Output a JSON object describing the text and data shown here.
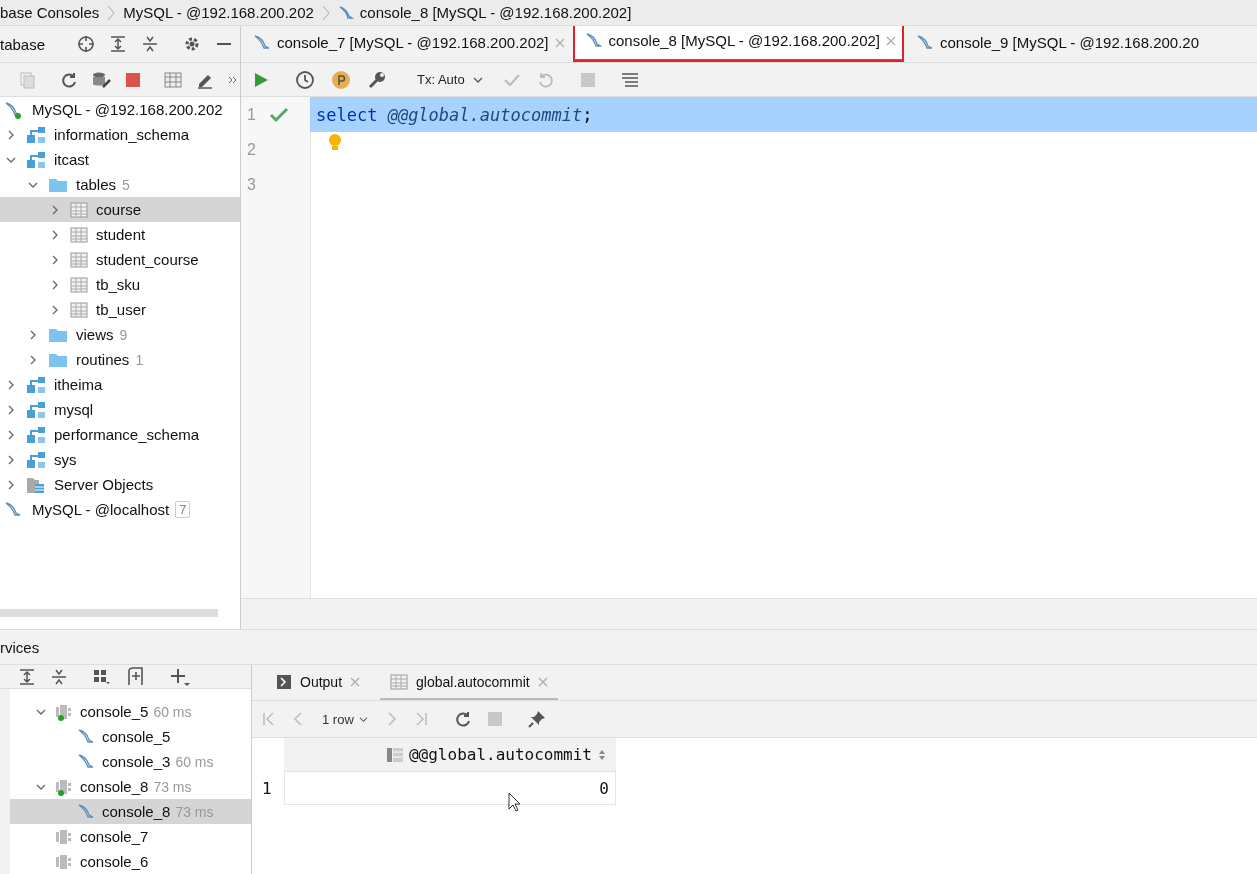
{
  "breadcrumbs": [
    {
      "text": "base Consoles",
      "kind": "plain"
    },
    {
      "text": "MySQL - @192.168.200.202",
      "kind": "plain"
    },
    {
      "text": "console_8 [MySQL - @192.168.200.202]",
      "kind": "console"
    }
  ],
  "database_panel": {
    "title": "tabase",
    "tree": [
      {
        "label": "MySQL - @192.168.200.202",
        "kind": "connection",
        "connected": true,
        "selected": false,
        "children": [
          {
            "label": "information_schema",
            "kind": "schema",
            "expanded": false,
            "selected": false
          },
          {
            "label": "itcast",
            "kind": "schema",
            "expanded": true,
            "selected": false,
            "children": [
              {
                "label": "tables",
                "count": "5",
                "kind": "folder",
                "expanded": true,
                "selected": false,
                "children": [
                  {
                    "label": "course",
                    "kind": "table",
                    "expanded": false,
                    "selected": true
                  },
                  {
                    "label": "student",
                    "kind": "table",
                    "expanded": false,
                    "selected": false
                  },
                  {
                    "label": "student_course",
                    "kind": "table",
                    "expanded": false,
                    "selected": false
                  },
                  {
                    "label": "tb_sku",
                    "kind": "table",
                    "expanded": false,
                    "selected": false
                  },
                  {
                    "label": "tb_user",
                    "kind": "table",
                    "expanded": false,
                    "selected": false
                  }
                ]
              },
              {
                "label": "views",
                "count": "9",
                "kind": "folder",
                "expanded": false,
                "selected": false
              },
              {
                "label": "routines",
                "count": "1",
                "kind": "folder",
                "expanded": false,
                "selected": false
              }
            ]
          },
          {
            "label": "itheima",
            "kind": "schema",
            "expanded": false,
            "selected": false
          },
          {
            "label": "mysql",
            "kind": "schema",
            "expanded": false,
            "selected": false
          },
          {
            "label": "performance_schema",
            "kind": "schema",
            "expanded": false,
            "selected": false
          },
          {
            "label": "sys",
            "kind": "schema",
            "expanded": false,
            "selected": false
          },
          {
            "label": "Server Objects",
            "kind": "server",
            "expanded": false,
            "selected": false
          }
        ]
      },
      {
        "label": "MySQL - @localhost",
        "count": "7",
        "kind": "connection",
        "connected": false,
        "selected": false
      }
    ]
  },
  "editor_tabs": [
    {
      "label": "console_7 [MySQL - @192.168.200.202]",
      "selected": false,
      "closable": true,
      "highlighted": false
    },
    {
      "label": "console_8 [MySQL - @192.168.200.202]",
      "selected": true,
      "closable": true,
      "highlighted": true
    },
    {
      "label": "console_9 [MySQL - @192.168.200.20",
      "selected": false,
      "closable": false,
      "highlighted": false
    }
  ],
  "editor_toolbar": {
    "transaction": "Tx: Auto"
  },
  "editor": {
    "lines": [
      {
        "number": "1",
        "executed": true,
        "selected": true,
        "hint": false,
        "tokens": [
          {
            "text": "select",
            "kind": "keyword"
          },
          {
            "text": " @@global.autocommit",
            "kind": "variable"
          },
          {
            "text": ";",
            "kind": "punct"
          }
        ]
      },
      {
        "number": "2",
        "executed": false,
        "selected": false,
        "hint": true
      },
      {
        "number": "3",
        "executed": false,
        "selected": false,
        "hint": false
      }
    ]
  },
  "services": {
    "title": "rvices",
    "tree": [
      {
        "label": "console_5",
        "time": "60 ms",
        "kind": "session",
        "connected": true,
        "expanded": true,
        "selected": false,
        "children": [
          {
            "label": "console_5",
            "kind": "console",
            "selected": false
          },
          {
            "label": "console_3",
            "time": "60 ms",
            "kind": "console",
            "selected": false
          }
        ]
      },
      {
        "label": "console_8",
        "time": "73 ms",
        "kind": "session",
        "connected": true,
        "expanded": true,
        "selected": false,
        "children": [
          {
            "label": "console_8",
            "time": "73 ms",
            "kind": "console",
            "selected": true
          }
        ]
      },
      {
        "label": "console_7",
        "kind": "session",
        "connected": false,
        "selected": false
      },
      {
        "label": "console_6",
        "kind": "session",
        "connected": false,
        "selected": false
      }
    ]
  },
  "results": {
    "tabs": [
      {
        "label": "Output",
        "kind": "output",
        "selected": false
      },
      {
        "label": "global.autocommit",
        "kind": "table",
        "selected": true
      }
    ],
    "pager": "1 row",
    "columns": [
      "@@global.autocommit"
    ],
    "rows": [
      {
        "number": "1",
        "cells": [
          "0"
        ]
      }
    ]
  }
}
